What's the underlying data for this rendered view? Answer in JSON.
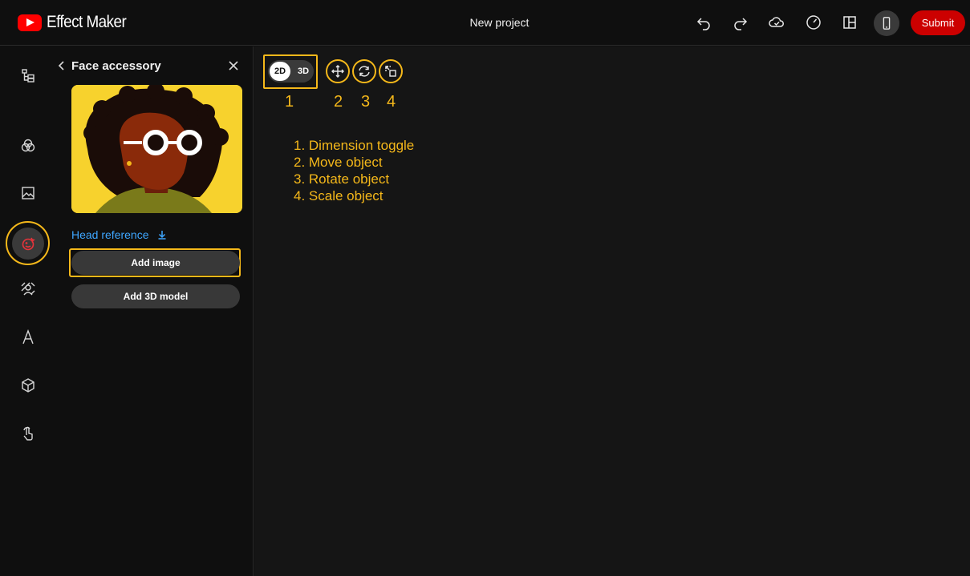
{
  "app": {
    "name": "Effect Maker",
    "project_title": "New project",
    "submit_label": "Submit"
  },
  "toolbar_icons": [
    "undo-icon",
    "redo-icon",
    "cloud-save-icon",
    "performance-gauge-icon",
    "layout-icon",
    "device-preview-icon"
  ],
  "rail": {
    "items": [
      "hierarchy-icon",
      "effects-icon",
      "image-icon",
      "face-icon",
      "background-icon",
      "text-icon",
      "3d-object-icon",
      "interaction-icon"
    ],
    "active": "face-icon"
  },
  "panel": {
    "title": "Face accessory",
    "head_reference_label": "Head reference",
    "add_image_label": "Add image",
    "add_3d_label": "Add 3D model"
  },
  "canvas_toolbar": {
    "dim_2d": "2D",
    "dim_3d": "3D",
    "numbers": [
      "1",
      "2",
      "3",
      "4"
    ]
  },
  "legend": [
    "1. Dimension toggle",
    "2. Move object",
    "3. Rotate object",
    "4. Scale object"
  ],
  "colors": {
    "highlight": "#f5b81a",
    "submit": "#cc0000",
    "link": "#3ea6ff",
    "brand_red": "#ff0000"
  }
}
